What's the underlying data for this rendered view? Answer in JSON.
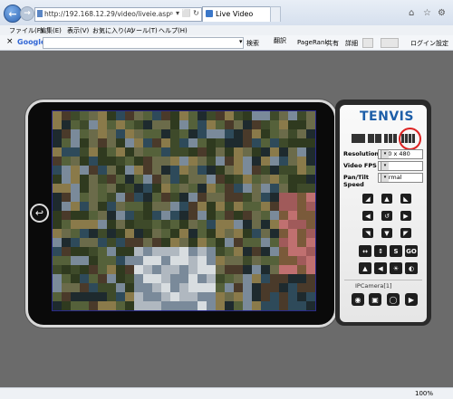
{
  "browser": {
    "address_url": "http://192.168.12.29/video/liveie.asp",
    "address_icons": "⌕ ▾ ⬜ ↻ ×",
    "tab_title": "Live Video",
    "menus": [
      "ファイル(F)",
      "編集(E)",
      "表示(V)",
      "お気に入り(A)",
      "ツール(T)",
      "ヘルプ(H)"
    ],
    "toolbar": {
      "close": "×",
      "google": "Google",
      "search": "検索",
      "translate": "翻訳",
      "pagerank": "PageRank",
      "share": "共有",
      "details": "詳細",
      "login": "ログイン",
      "settings": "設定"
    },
    "zoom": "100%"
  },
  "viewer": {
    "brand": "TENVIS",
    "resolution_label": "Resolution",
    "resolution_value": "640 x 480",
    "fps_label": "Video FPS",
    "fps_value": "30",
    "pantilt_label": "Pan/Tilt",
    "pantilt_label2": "Speed",
    "pantilt_value": "Normal",
    "camera_name": "IPCamera[1]",
    "func_labels": [
      "↔",
      "↕",
      "S",
      "GO"
    ],
    "dropdown_icon": "▾"
  },
  "colors": {
    "brand": "#1d5ea8",
    "highlight_circle": "#dd2222"
  }
}
